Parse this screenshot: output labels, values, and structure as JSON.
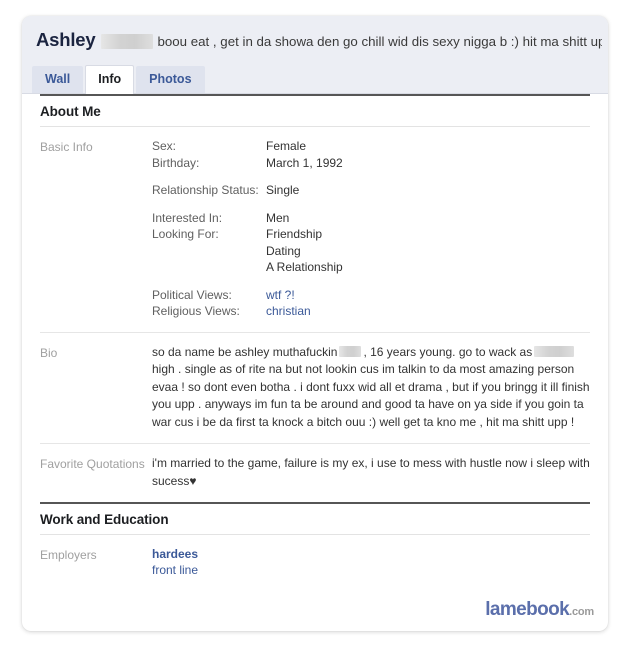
{
  "profile": {
    "name": "Ashley",
    "name_redacted": true,
    "status": "boou eat , get in da showa den go chill wid dis sexy nigga b :) hit ma shitt uppp !"
  },
  "tabs": [
    {
      "label": "Wall",
      "active": false
    },
    {
      "label": "Info",
      "active": true
    },
    {
      "label": "Photos",
      "active": false
    }
  ],
  "sections": {
    "about_me": {
      "title": "About Me",
      "basic_info": {
        "label": "Basic Info",
        "groups": [
          {
            "items": [
              {
                "key": "Sex:",
                "value": "Female"
              },
              {
                "key": "Birthday:",
                "value": "March 1, 1992"
              }
            ]
          },
          {
            "items": [
              {
                "key": "Relationship Status:",
                "value": "Single"
              }
            ]
          },
          {
            "items": [
              {
                "key": "Interested In:",
                "value": "Men"
              },
              {
                "key": "Looking For:",
                "value": "Friendship\nDating\nA Relationship"
              }
            ]
          },
          {
            "items": [
              {
                "key": "Political Views:",
                "value": "wtf ?!",
                "is_link": true
              },
              {
                "key": "Religious Views:",
                "value": "christian",
                "is_link": true
              }
            ]
          }
        ]
      },
      "bio": {
        "label": "Bio",
        "text_part1": "so da name be ashley muthafuckin",
        "text_part2": ", 16 years young. go to wack as",
        "text_part3": "high . single as of rite na but not lookin cus im talkin to da most amazing person evaa ! so dont even botha . i dont fuxx wid all et drama , but if you bringg it ill finish you upp . anyways im fun ta be around and good ta have on ya side if you goin ta war cus i be da first ta knock a bitch ouu :) well get ta kno me , hit ma shitt upp !"
      },
      "favorite_quotations": {
        "label": "Favorite Quotations",
        "text": "i'm married to the game, failure is my ex, i use to mess with hustle now i sleep with sucess♥"
      }
    },
    "work_and_education": {
      "title": "Work and Education",
      "employers": {
        "label": "Employers",
        "primary": "hardees",
        "secondary": "front line"
      }
    }
  },
  "watermark": {
    "main": "lamebook",
    "tld": ".com"
  },
  "colors": {
    "link": "#3b5998",
    "header_bg": "#eceef4",
    "tab_bg": "#dfe3ee",
    "watermark_blue": "#5b6fab"
  }
}
